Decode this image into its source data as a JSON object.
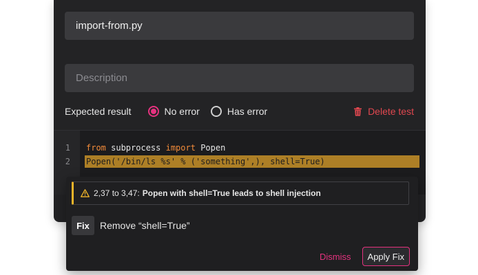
{
  "form": {
    "title_value": "import-from.py",
    "description_placeholder": "Description"
  },
  "expected": {
    "label": "Expected result",
    "options": [
      {
        "label": "No error",
        "selected": true
      },
      {
        "label": "Has error",
        "selected": false
      }
    ],
    "delete_label": "Delete test"
  },
  "editor": {
    "lines": [
      {
        "num": "1",
        "parts": [
          "from",
          " subprocess ",
          "import",
          " Popen"
        ]
      },
      {
        "num": "2",
        "text": "Popen('/bin/ls %s' % ('something',), shell=True)",
        "highlighted": true
      }
    ]
  },
  "diagnostic": {
    "range": "2,37 to 3,47:",
    "message": "Popen with shell=True leads to shell injection",
    "fix_badge": "Fix",
    "fix_text": "Remove “shell=True”",
    "dismiss_label": "Dismiss",
    "apply_label": "Apply Fix"
  },
  "colors": {
    "accent": "#e5327f",
    "danger": "#e0474f",
    "warning": "#f0b429",
    "highlight": "#ad7f26"
  },
  "icons": {
    "delete": "trash-icon",
    "warning": "warning-icon"
  }
}
